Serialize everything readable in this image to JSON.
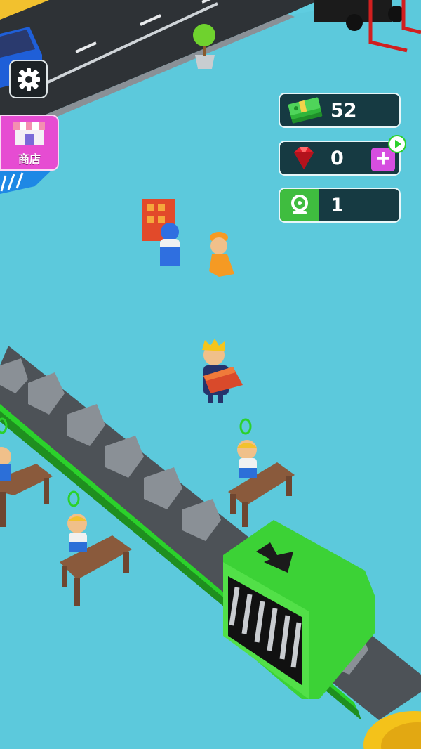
{
  "hud": {
    "cash": "52",
    "gems": "0",
    "level": "1"
  },
  "shop": {
    "label": "商店"
  },
  "icons": {
    "settings": "gear-icon",
    "cash": "cash-stack-icon",
    "gem": "ruby-gem-icon",
    "add": "plus-icon",
    "video": "play-video-icon",
    "level": "level-badge-icon",
    "shop": "storefront-icon"
  },
  "colors": {
    "ground": "#5cc9dc",
    "road": "#2e3236",
    "conveyor": "#4d5257",
    "machine": "#45dc3a",
    "hud_bg": "#163a42",
    "shop_button": "#e64cd2"
  }
}
